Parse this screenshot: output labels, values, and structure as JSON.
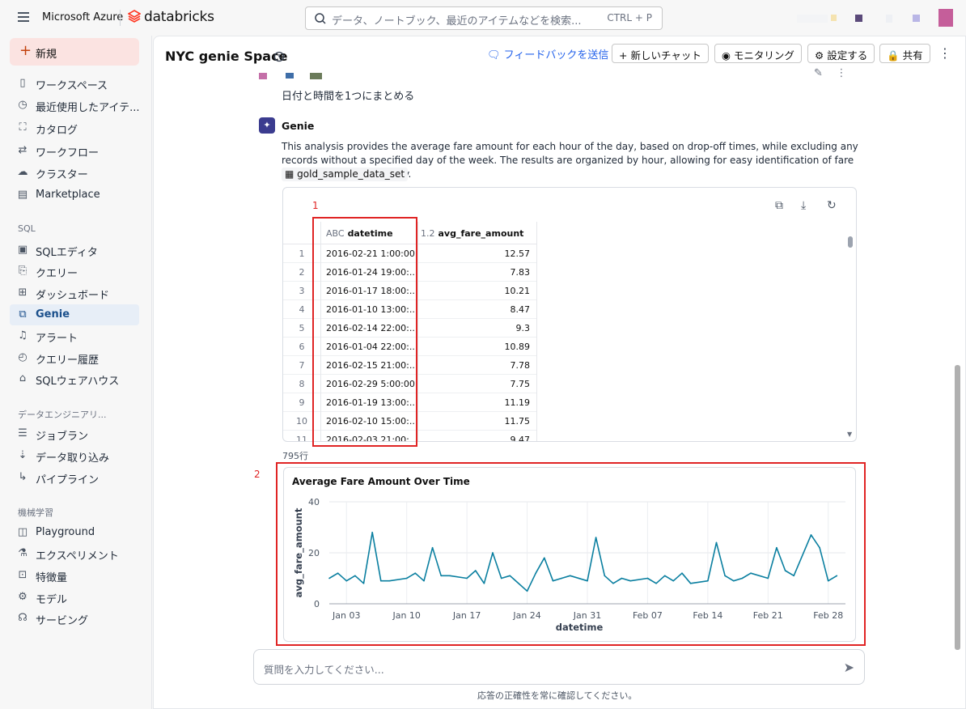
{
  "topbar": {
    "brand_ms": "Microsoft Azure",
    "brand_db": "databricks",
    "search_placeholder": "データ、ノートブック、最近のアイテムなどを検索...",
    "search_shortcut": "CTRL + P"
  },
  "sidebar": {
    "new_label": "新規",
    "items": [
      {
        "label": "ワークスペース",
        "icon": "folder-icon"
      },
      {
        "label": "最近使用したアイテ...",
        "icon": "clock-icon"
      },
      {
        "label": "カタログ",
        "icon": "catalog-icon"
      },
      {
        "label": "ワークフロー",
        "icon": "workflow-icon"
      },
      {
        "label": "クラスター",
        "icon": "cloud-icon"
      },
      {
        "label": "Marketplace",
        "icon": "store-icon"
      }
    ],
    "sql_section": "SQL",
    "sql_items": [
      {
        "label": "SQLエディタ",
        "icon": "sql-editor-icon"
      },
      {
        "label": "クエリー",
        "icon": "query-icon"
      },
      {
        "label": "ダッシュボード",
        "icon": "dashboard-icon"
      },
      {
        "label": "Genie",
        "icon": "genie-icon",
        "active": true
      },
      {
        "label": "アラート",
        "icon": "bell-icon"
      },
      {
        "label": "クエリー履歴",
        "icon": "history-icon"
      },
      {
        "label": "SQLウェアハウス",
        "icon": "warehouse-icon"
      }
    ],
    "de_section": "データエンジニアリ...",
    "de_items": [
      {
        "label": "ジョブラン",
        "icon": "job-icon"
      },
      {
        "label": "データ取り込み",
        "icon": "ingest-icon"
      },
      {
        "label": "パイプライン",
        "icon": "pipeline-icon"
      }
    ],
    "ml_section": "機械学習",
    "ml_items": [
      {
        "label": "Playground",
        "icon": "playground-icon"
      },
      {
        "label": "エクスペリメント",
        "icon": "flask-icon"
      },
      {
        "label": "特徴量",
        "icon": "feature-icon"
      },
      {
        "label": "モデル",
        "icon": "model-icon"
      },
      {
        "label": "サービング",
        "icon": "serving-icon"
      }
    ]
  },
  "header": {
    "title": "NYC genie Space",
    "feedback": "フィードバックを送信",
    "new_chat": "新しいチャット",
    "monitoring": "モニタリング",
    "settings": "設定する",
    "share": "共有"
  },
  "conversation": {
    "user_message": "日付と時間を1つにまとめる",
    "assistant_name": "Genie",
    "assistant_text": "This analysis provides the average fare amount for each hour of the day, based on drop-off times, while excluding any records without a specified day of the week. The results are organized by hour, allowing for easy identification of fare trends throughout the day.",
    "table_chip": "gold_sample_data_set"
  },
  "results": {
    "columns": [
      {
        "type": "ABC",
        "name": "datetime"
      },
      {
        "type": "1.2",
        "name": "avg_fare_amount"
      }
    ],
    "rows": [
      {
        "i": "1",
        "datetime": "2016-02-21 1:00:00",
        "fare": "12.57"
      },
      {
        "i": "2",
        "datetime": "2016-01-24 19:00:...",
        "fare": "7.83"
      },
      {
        "i": "3",
        "datetime": "2016-01-17 18:00:...",
        "fare": "10.21"
      },
      {
        "i": "4",
        "datetime": "2016-01-10 13:00:...",
        "fare": "8.47"
      },
      {
        "i": "5",
        "datetime": "2016-02-14 22:00:...",
        "fare": "9.3"
      },
      {
        "i": "6",
        "datetime": "2016-01-04 22:00:...",
        "fare": "10.89"
      },
      {
        "i": "7",
        "datetime": "2016-02-15 21:00:...",
        "fare": "7.78"
      },
      {
        "i": "8",
        "datetime": "2016-02-29 5:00:00",
        "fare": "7.75"
      },
      {
        "i": "9",
        "datetime": "2016-01-19 13:00:...",
        "fare": "11.19"
      },
      {
        "i": "10",
        "datetime": "2016-02-10 15:00:...",
        "fare": "11.75"
      },
      {
        "i": "11",
        "datetime": "2016-02-03 21:00:...",
        "fare": "9.47"
      }
    ],
    "row_count": "795行"
  },
  "annotations": {
    "one": "1",
    "two": "2"
  },
  "chart_data": {
    "type": "line",
    "title": "Average Fare Amount Over Time",
    "xlabel": "datetime",
    "ylabel": "avg_fare_amount",
    "ylim": [
      0,
      40
    ],
    "yticks": [
      "0",
      "20",
      "40"
    ],
    "xticks": [
      "Jan 03",
      "Jan 10",
      "Jan 17",
      "Jan 24",
      "Jan 31",
      "Feb 07",
      "Feb 14",
      "Feb 21",
      "Feb 28"
    ],
    "xdomain": [
      "2016-01-01",
      "2016-03-01"
    ],
    "series": [
      {
        "color": "#0a7fa0",
        "x": [
          "2016-01-01",
          "2016-01-02",
          "2016-01-03",
          "2016-01-04",
          "2016-01-05",
          "2016-01-06",
          "2016-01-07",
          "2016-01-08",
          "2016-01-10",
          "2016-01-11",
          "2016-01-12",
          "2016-01-13",
          "2016-01-14",
          "2016-01-15",
          "2016-01-17",
          "2016-01-18",
          "2016-01-19",
          "2016-01-20",
          "2016-01-21",
          "2016-01-22",
          "2016-01-24",
          "2016-01-25",
          "2016-01-26",
          "2016-01-27",
          "2016-01-28",
          "2016-01-29",
          "2016-01-31",
          "2016-02-01",
          "2016-02-02",
          "2016-02-03",
          "2016-02-04",
          "2016-02-05",
          "2016-02-07",
          "2016-02-08",
          "2016-02-09",
          "2016-02-10",
          "2016-02-11",
          "2016-02-12",
          "2016-02-14",
          "2016-02-15",
          "2016-02-16",
          "2016-02-17",
          "2016-02-18",
          "2016-02-19",
          "2016-02-21",
          "2016-02-22",
          "2016-02-23",
          "2016-02-24",
          "2016-02-26",
          "2016-02-27",
          "2016-02-28",
          "2016-02-29"
        ],
        "y": [
          10,
          12,
          9,
          11,
          8,
          28,
          9,
          9,
          10,
          12,
          9,
          22,
          11,
          11,
          10,
          13,
          8,
          20,
          10,
          11,
          5,
          12,
          18,
          9,
          10,
          11,
          9,
          26,
          11,
          8,
          10,
          9,
          10,
          8,
          11,
          9,
          12,
          8,
          9,
          24,
          11,
          9,
          10,
          12,
          10,
          22,
          13,
          11,
          27,
          22,
          9,
          11
        ]
      }
    ]
  },
  "input": {
    "placeholder": "質問を入力してください...",
    "disclaimer": "応答の正確性を常に確認してください。"
  }
}
